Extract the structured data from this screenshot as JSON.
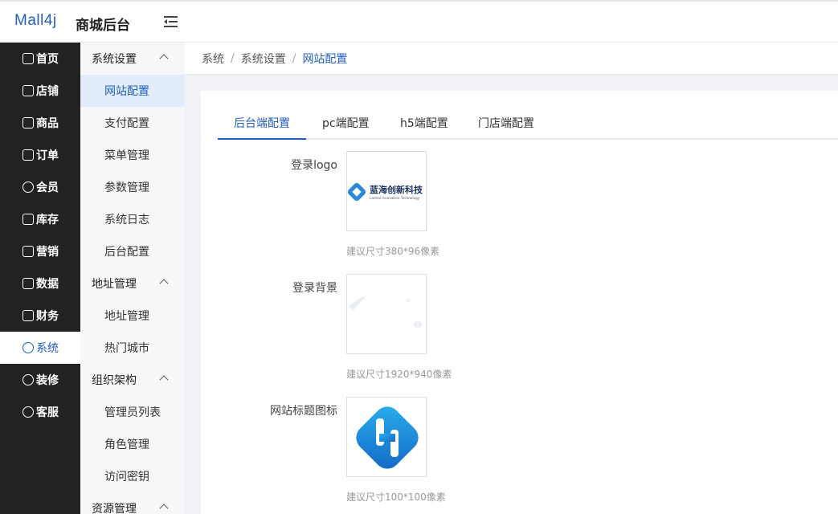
{
  "header": {
    "logo": "Mall4j",
    "title": "商城后台"
  },
  "nav": [
    {
      "label": "首页",
      "icon": "home-icon",
      "active": false
    },
    {
      "label": "店铺",
      "icon": "shop-icon",
      "active": false
    },
    {
      "label": "商品",
      "icon": "goods-icon",
      "active": false
    },
    {
      "label": "订单",
      "icon": "order-icon",
      "active": false
    },
    {
      "label": "会员",
      "icon": "member-icon",
      "active": false
    },
    {
      "label": "库存",
      "icon": "stock-icon",
      "active": false
    },
    {
      "label": "营销",
      "icon": "gift-icon",
      "active": false
    },
    {
      "label": "数据",
      "icon": "data-icon",
      "active": false
    },
    {
      "label": "财务",
      "icon": "finance-icon",
      "active": false
    },
    {
      "label": "系统",
      "icon": "gear-icon",
      "active": true
    },
    {
      "label": "装修",
      "icon": "decorate-icon",
      "active": false
    },
    {
      "label": "客服",
      "icon": "chat-icon",
      "active": false
    }
  ],
  "submenu": {
    "group1": "系统设置",
    "items1": [
      "网站配置",
      "支付配置",
      "菜单管理",
      "参数管理",
      "系统日志",
      "后台配置"
    ],
    "group2": "地址管理",
    "items2": [
      "地址管理",
      "热门城市"
    ],
    "group3": "组织架构",
    "items3": [
      "管理员列表",
      "角色管理",
      "访问密钥"
    ],
    "group4": "资源管理"
  },
  "breadcrumb": {
    "c1": "系统",
    "c2": "系统设置",
    "c3": "网站配置",
    "sep": "/"
  },
  "tabs": [
    "后台端配置",
    "pc端配置",
    "h5端配置",
    "门店端配置"
  ],
  "fields": {
    "logo_label": "登录logo",
    "logo_brand": "蓝海创新科技",
    "logo_brand_en": "Lanhai Innovation Technology",
    "logo_hint": "建议尺寸380*96像素",
    "bg_label": "登录背景",
    "bg_hint": "建议尺寸1920*940像素",
    "favicon_label": "网站标题图标",
    "favicon_hint": "建议尺寸100*100像素"
  },
  "colors": {
    "accent": "#1f5fbf",
    "nav_bg": "#222222",
    "submenu_bg": "#f6f7f9",
    "main_bg": "#f0f2f5"
  }
}
